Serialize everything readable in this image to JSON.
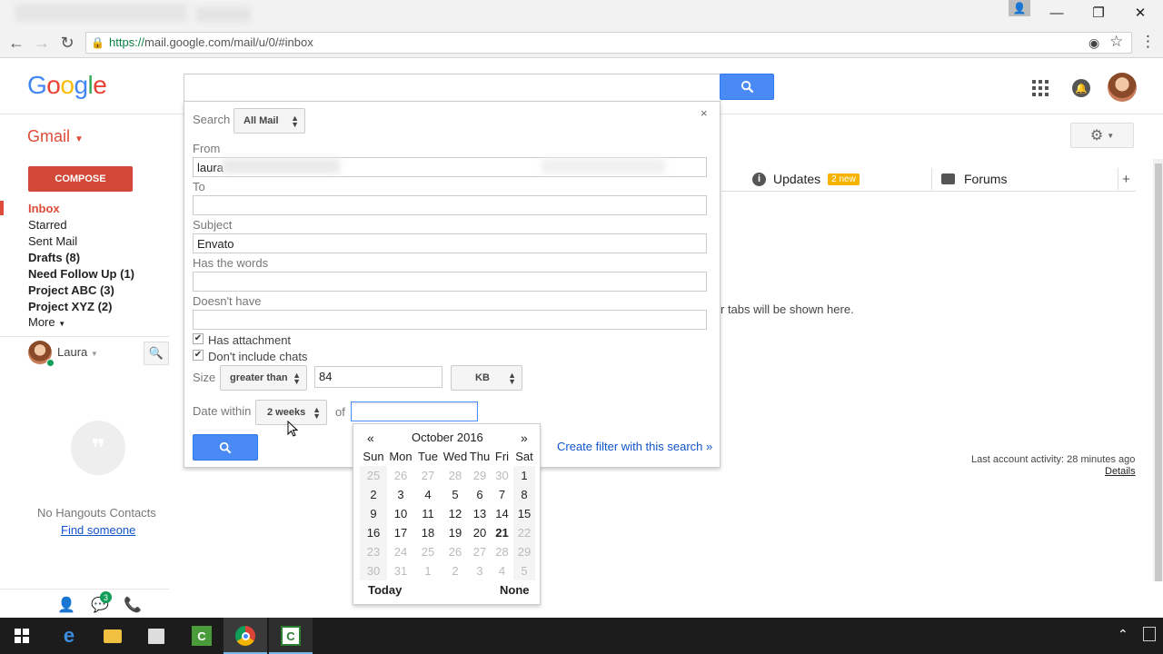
{
  "browser": {
    "url_proto": "https://",
    "url_rest": "mail.google.com/mail/u/0/#inbox"
  },
  "header": {
    "logo": [
      "G",
      "o",
      "o",
      "g",
      "l",
      "e"
    ],
    "logo_colors": [
      "#4285f4",
      "#ea4335",
      "#fbbc05",
      "#4285f4",
      "#34a853",
      "#ea4335"
    ],
    "app_label": "Gmail"
  },
  "sidebar": {
    "compose": "COMPOSE",
    "items": [
      {
        "label": "Inbox"
      },
      {
        "label": "Starred"
      },
      {
        "label": "Sent Mail"
      },
      {
        "label": "Drafts (8)"
      },
      {
        "label": "Need Follow Up (1)"
      },
      {
        "label": "Project ABC (3)"
      },
      {
        "label": "Project XYZ (2)"
      },
      {
        "label": "More"
      }
    ]
  },
  "hangouts": {
    "user": "Laura",
    "no_contacts": "No Hangouts Contacts",
    "find": "Find someone",
    "badge": "3"
  },
  "tabs": {
    "updates": "Updates",
    "updates_badge": "2 new",
    "forums": "Forums",
    "message": "r tabs will be shown here."
  },
  "footer": {
    "last_activity": "Last account activity: 28 minutes ago",
    "details": "Details"
  },
  "advanced_search": {
    "search_label": "Search",
    "search_scope": "All Mail",
    "from_label": "From",
    "from_value": "laura",
    "to_label": "To",
    "subject_label": "Subject",
    "subject_value": "Envato",
    "has_words_label": "Has the words",
    "doesnt_have_label": "Doesn't have",
    "has_attachment": "Has attachment",
    "no_chats": "Don't include chats",
    "size_label": "Size",
    "size_op": "greater than",
    "size_value": "84",
    "size_unit": "KB",
    "date_label": "Date within",
    "date_range": "2 weeks",
    "of_label": "of",
    "create_filter": "Create filter with this search »",
    "close": "×"
  },
  "calendar": {
    "prev": "«",
    "next": "»",
    "month": "October 2016",
    "weekdays": [
      "Sun",
      "Mon",
      "Tue",
      "Wed",
      "Thu",
      "Fri",
      "Sat"
    ],
    "days": [
      [
        "25",
        "26",
        "27",
        "28",
        "29",
        "30",
        "1"
      ],
      [
        "2",
        "3",
        "4",
        "5",
        "6",
        "7",
        "8"
      ],
      [
        "9",
        "10",
        "11",
        "12",
        "13",
        "14",
        "15"
      ],
      [
        "16",
        "17",
        "18",
        "19",
        "20",
        "21",
        "22"
      ],
      [
        "23",
        "24",
        "25",
        "26",
        "27",
        "28",
        "29"
      ],
      [
        "30",
        "31",
        "1",
        "2",
        "3",
        "4",
        "5"
      ]
    ],
    "today_label": "Today",
    "none_label": "None"
  }
}
